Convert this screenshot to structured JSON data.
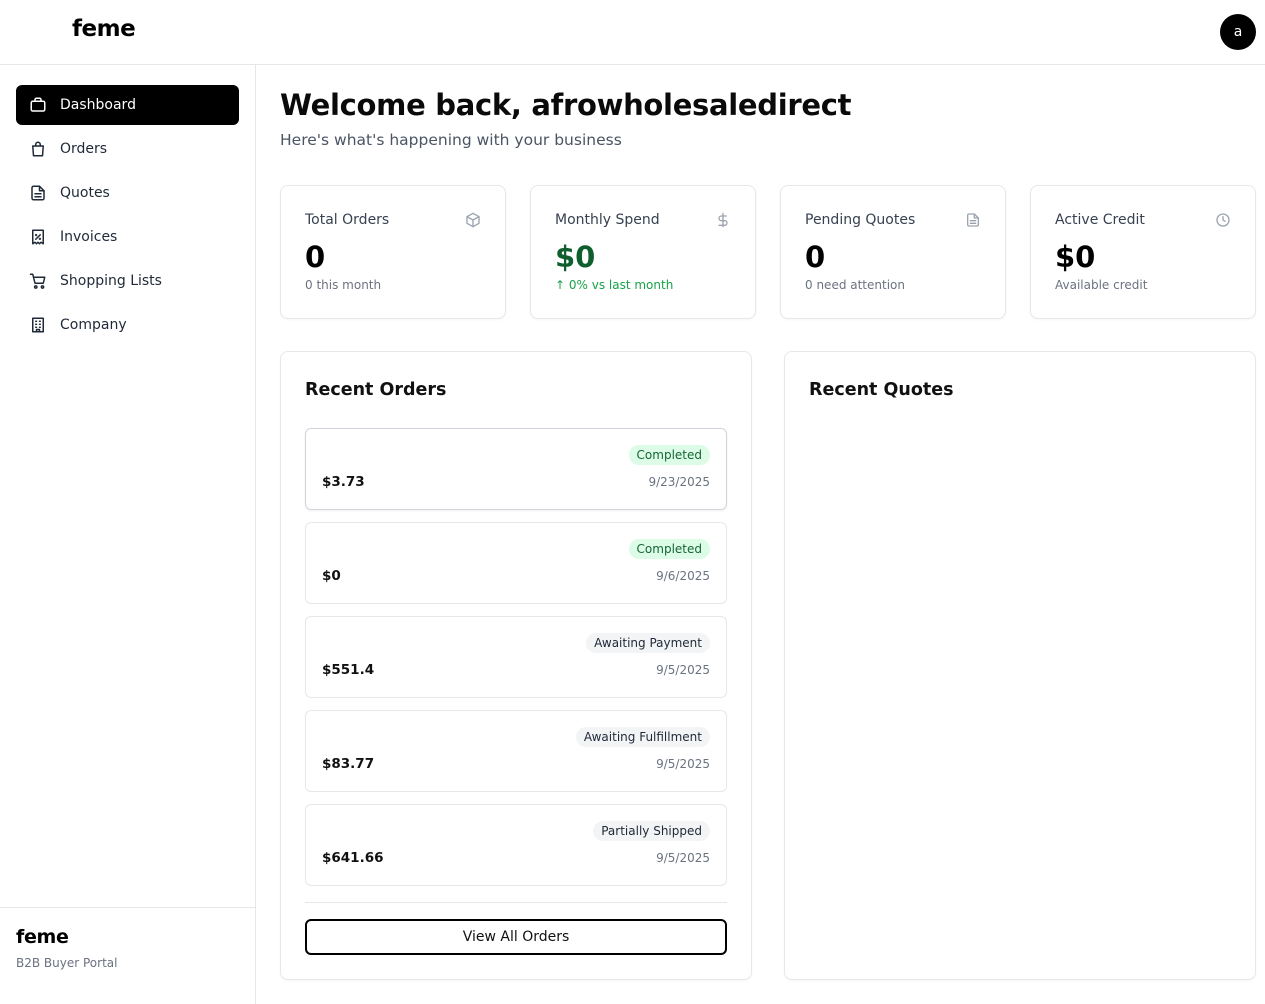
{
  "header": {
    "brand": "feme",
    "avatar_initial": "a"
  },
  "sidebar": {
    "items": [
      {
        "label": "Dashboard",
        "icon": "briefcase-icon",
        "active": true
      },
      {
        "label": "Orders",
        "icon": "shopping-bag-icon"
      },
      {
        "label": "Quotes",
        "icon": "file-text-icon"
      },
      {
        "label": "Invoices",
        "icon": "receipt-percent-icon"
      },
      {
        "label": "Shopping Lists",
        "icon": "shopping-cart-icon"
      },
      {
        "label": "Company",
        "icon": "building-icon"
      }
    ],
    "footer": {
      "brand": "feme",
      "subtitle": "B2B Buyer Portal"
    }
  },
  "main": {
    "welcome": "Welcome back, afrowholesaledirect",
    "subtitle": "Here's what's happening with your business",
    "stats": [
      {
        "label": "Total Orders",
        "icon": "package-icon",
        "value": "0",
        "sub": "0 this month"
      },
      {
        "label": "Monthly Spend",
        "icon": "dollar-icon",
        "value": "$0",
        "sub": "↑ 0% vs last month"
      },
      {
        "label": "Pending Quotes",
        "icon": "document-icon",
        "value": "0",
        "sub": "0 need attention"
      },
      {
        "label": "Active Credit",
        "icon": "clock-icon",
        "value": "$0",
        "sub": "Available credit"
      }
    ],
    "recent_orders": {
      "title": "Recent Orders",
      "orders": [
        {
          "amount": "$3.73",
          "status": "Completed",
          "date": "9/23/2025"
        },
        {
          "amount": "$0",
          "status": "Completed",
          "date": "9/6/2025"
        },
        {
          "amount": "$551.4",
          "status": "Awaiting Payment",
          "date": "9/5/2025"
        },
        {
          "amount": "$83.77",
          "status": "Awaiting Fulfillment",
          "date": "9/5/2025"
        },
        {
          "amount": "$641.66",
          "status": "Partially Shipped",
          "date": "9/5/2025"
        }
      ],
      "view_all_label": "View All Orders"
    },
    "recent_quotes": {
      "title": "Recent Quotes"
    }
  },
  "colors": {
    "active_nav_bg": "#000000",
    "completed_badge_bg": "#dcfce7",
    "completed_badge_text": "#166534",
    "neutral_badge_bg": "#f3f4f6",
    "positive_text": "#16a34a"
  }
}
